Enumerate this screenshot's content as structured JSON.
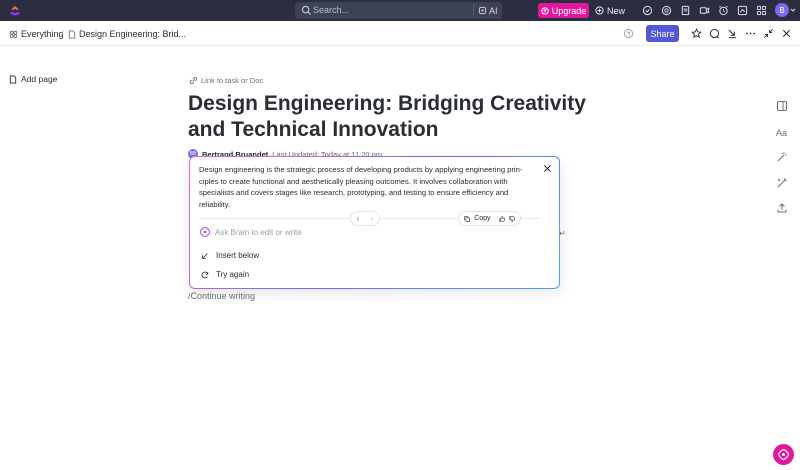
{
  "topbar": {
    "search_placeholder": "Search...",
    "ai_label": "AI",
    "upgrade_label": "Upgrade",
    "new_label": "New",
    "avatar_initial": "B"
  },
  "breadcrumb": {
    "root": "Everything",
    "separator": "/",
    "current": "Design Engineering: Brid..."
  },
  "toolbar": {
    "share_label": "Share"
  },
  "sidebar": {
    "add_page_label": "Add page"
  },
  "doc": {
    "link_label": "Link to task or Doc",
    "title": "Design Engineering: Bridging Creativity and Technical Innovation",
    "author_initials": "BB",
    "author": "Bertrand Bruandet",
    "last_updated": "Last Updated: Today at 11:20 pm",
    "continue_label": "/Continue writing"
  },
  "ai_popover": {
    "response": "Design engineering is the strategic process of developing products by applying engineering prin-ciples to create functional and aesthetically pleasing outcomes. It involves collaboration with specialists and covers stages like research, prototyping, and testing to ensure efficiency and reliability.",
    "copy_label": "Copy",
    "prev_glyph": "‹",
    "next_glyph": "›",
    "ask_placeholder": "Ask Brain to edit or write",
    "insert_label": "Insert below",
    "retry_label": "Try again"
  },
  "colors": {
    "topbar_bg": "#2a2e40",
    "upgrade": "#e0199c",
    "share": "#5457d6",
    "brain_accent": "#7b68ee"
  }
}
